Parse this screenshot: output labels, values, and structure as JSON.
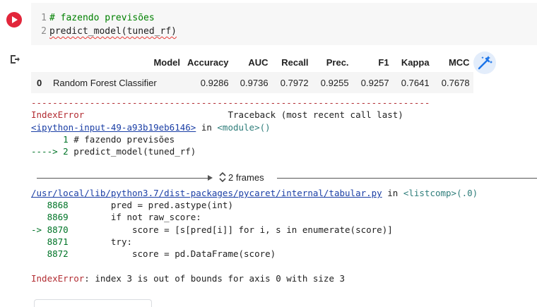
{
  "code_cell": {
    "lines": [
      {
        "num": "1",
        "text": "# fazendo previsões"
      },
      {
        "num": "2",
        "text": "predict_model(tuned_rf)"
      }
    ]
  },
  "colors": {
    "run_button": "#e2263b",
    "error_red": "#b22b31",
    "link_blue": "#1a3ea5",
    "comment_green": "#008000"
  },
  "icons": {
    "run": "play-icon",
    "output": "output-redirect-icon",
    "magic": "magic-wand-icon",
    "expand": "chevron-up-down-icon"
  },
  "table": {
    "columns": [
      "",
      "Model",
      "Accuracy",
      "AUC",
      "Recall",
      "Prec.",
      "F1",
      "Kappa",
      "MCC"
    ],
    "rows": [
      [
        "0",
        "Random Forest Classifier",
        "0.9286",
        "0.9736",
        "0.7972",
        "0.9255",
        "0.9257",
        "0.7641",
        "0.7678"
      ]
    ]
  },
  "traceback": {
    "dashes": "---------------------------------------------------------------------------",
    "error_type": "IndexError",
    "header_right": "Traceback (most recent call last)",
    "cell_link": "<ipython-input-49-a93b19eb6146>",
    "in_word": " in ",
    "module": "<module>()",
    "ctx_line1_num": "1",
    "ctx_line1_text": "# fazendo previsões",
    "ctx_arrow": "---->",
    "ctx_line2_num": "2",
    "ctx_line2_text": "predict_model(tuned_rf)",
    "frames_label": "2 frames",
    "file_link": "/usr/local/lib/python3.7/dist-packages/pycaret/internal/tabular.py",
    "file_in": " in ",
    "listcomp": "<listcomp>(.0)",
    "src": [
      {
        "marker": "   ",
        "num": "8868",
        "code": "        pred = pred.astype(int)"
      },
      {
        "marker": "   ",
        "num": "8869",
        "code": "        if not raw_score:"
      },
      {
        "marker": "-> ",
        "num": "8870",
        "code": "            score = [s[pred[i]] for i, s in enumerate(score)]"
      },
      {
        "marker": "   ",
        "num": "8871",
        "code": "        try:"
      },
      {
        "marker": "   ",
        "num": "8872",
        "code": "            score = pd.DataFrame(score)"
      }
    ],
    "final_type": "IndexError",
    "final_msg": ": index 3 is out of bounds for axis 0 with size 3"
  }
}
